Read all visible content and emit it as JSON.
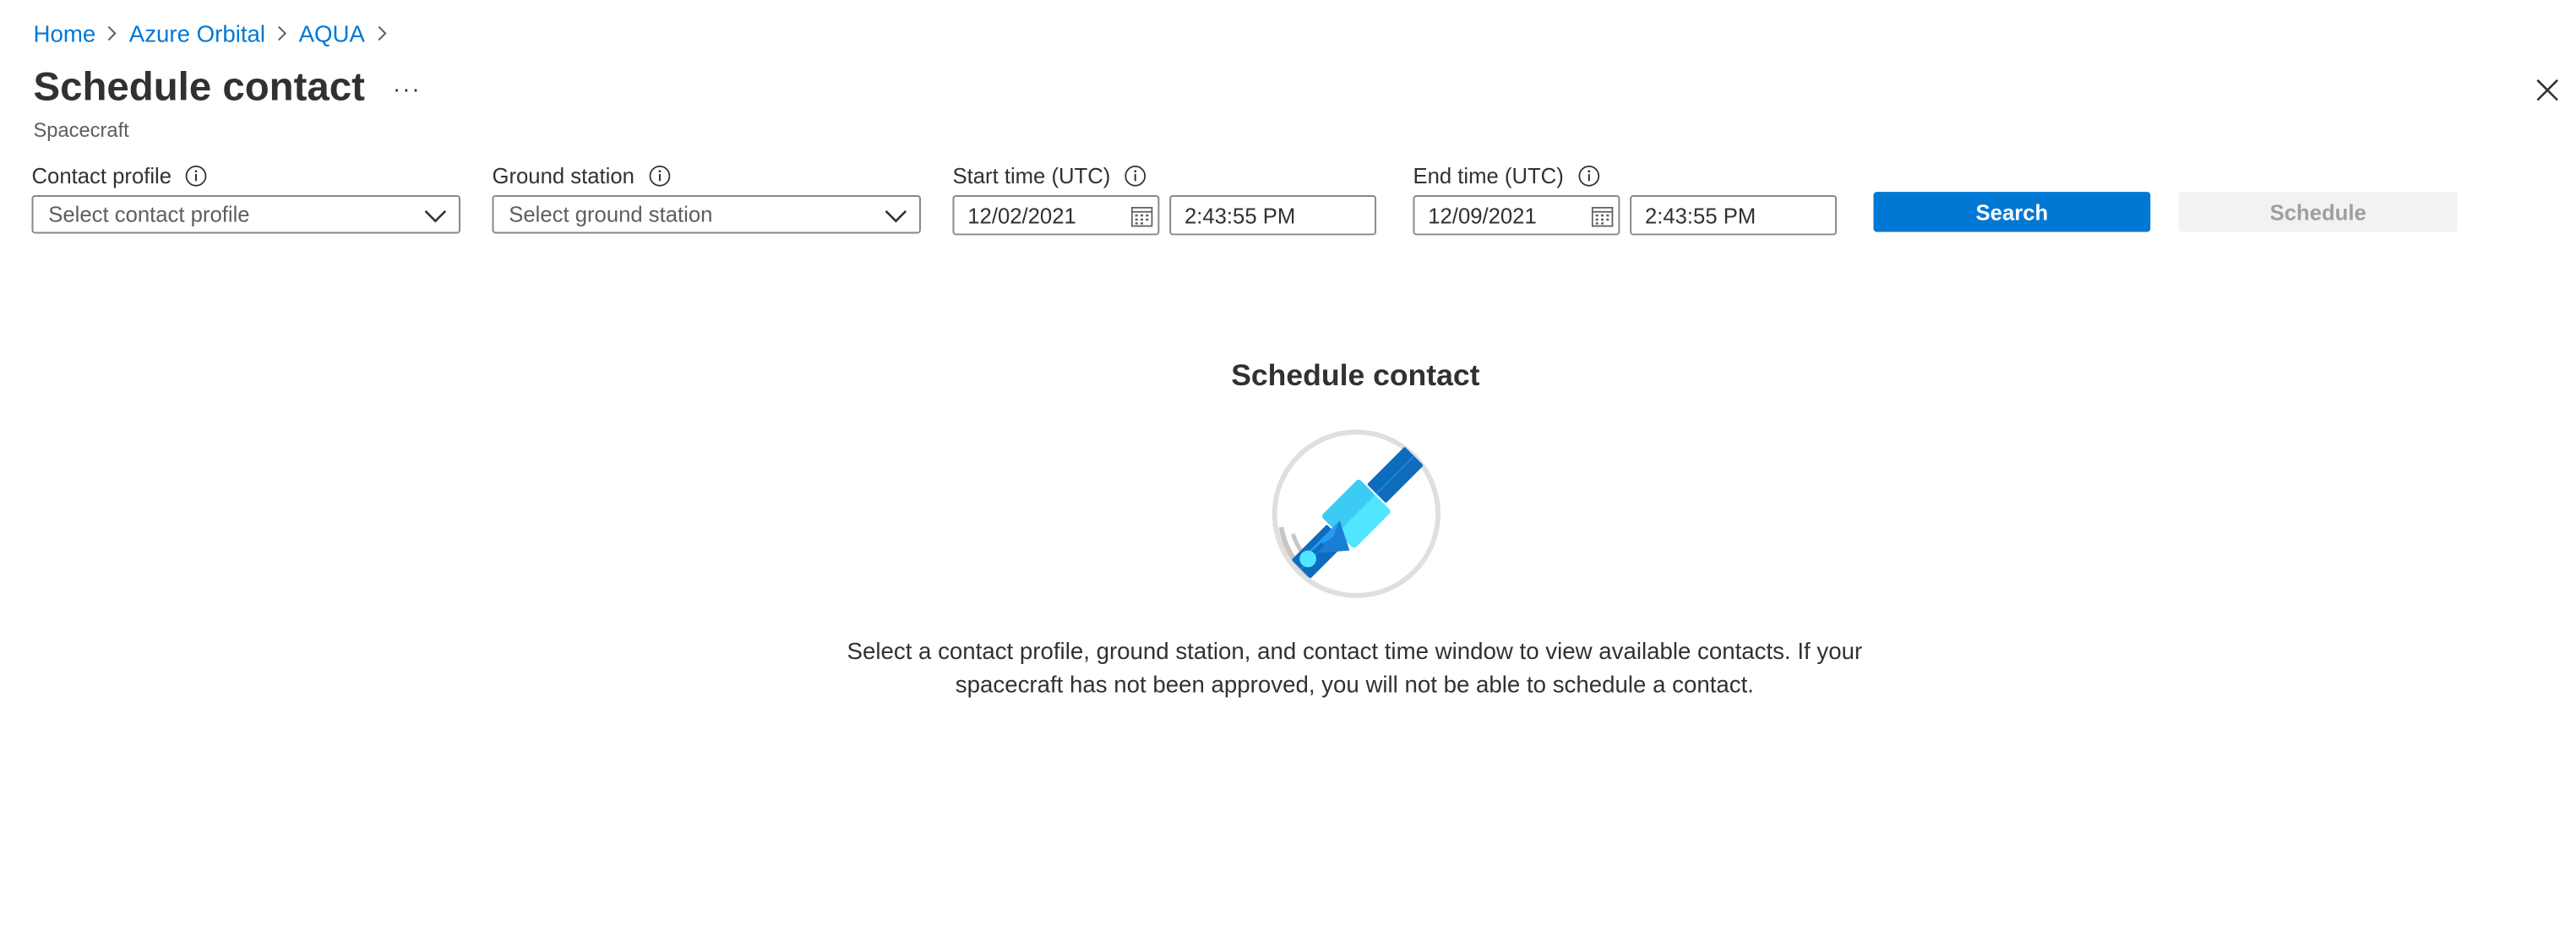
{
  "breadcrumb": {
    "items": [
      "Home",
      "Azure Orbital",
      "AQUA"
    ]
  },
  "header": {
    "title": "Schedule contact",
    "more_label": "···",
    "subtitle": "Spacecraft"
  },
  "filters": {
    "contact_profile": {
      "label": "Contact profile",
      "placeholder": "Select contact profile"
    },
    "ground_station": {
      "label": "Ground station",
      "placeholder": "Select ground station"
    },
    "start_time": {
      "label": "Start time (UTC)",
      "date": "12/02/2021",
      "time": "2:43:55 PM"
    },
    "end_time": {
      "label": "End time (UTC)",
      "date": "12/09/2021",
      "time": "2:43:55 PM"
    }
  },
  "actions": {
    "search_label": "Search",
    "schedule_label": "Schedule"
  },
  "empty_state": {
    "title": "Schedule contact",
    "message_line1": "Select a contact profile, ground station, and contact time window to view available contacts. If your",
    "message_line2": "spacecraft has not been approved, you will not be able to schedule a contact."
  },
  "colors": {
    "accent": "#0078d4",
    "text": "#323130",
    "secondary_text": "#605e5c",
    "border": "#8a8886",
    "disabled_bg": "#f3f2f1",
    "disabled_text": "#a19f9d"
  },
  "icons": {
    "breadcrumb_separator": "chevron-right-icon",
    "more": "ellipsis-icon",
    "close": "close-icon",
    "info": "info-icon",
    "dropdown": "chevron-down-icon",
    "calendar": "calendar-icon",
    "illustration": "satellite-icon"
  }
}
